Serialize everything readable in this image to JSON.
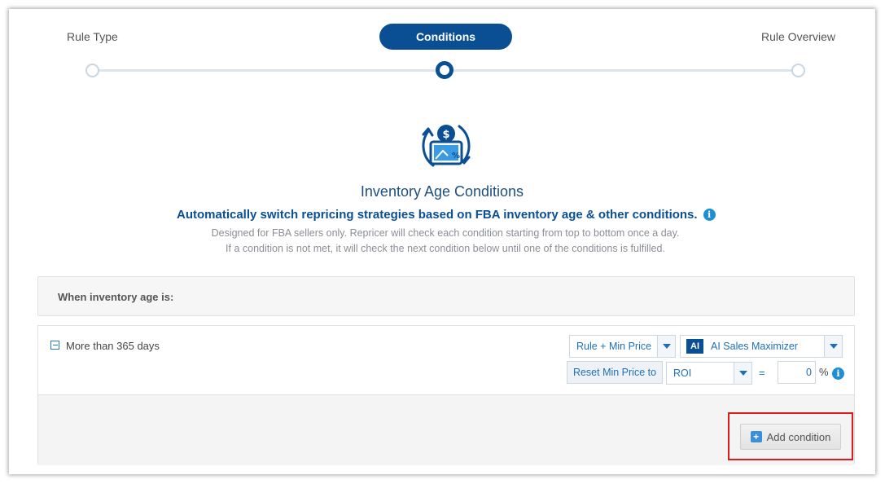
{
  "stepper": {
    "steps": [
      {
        "label": "Rule Type",
        "state": "done"
      },
      {
        "label": "Conditions",
        "state": "active"
      },
      {
        "label": "Rule Overview",
        "state": "pending"
      }
    ]
  },
  "header": {
    "icon": "inventory-repricing-icon",
    "title": "Inventory Age Conditions",
    "subtitle": "Automatically switch repricing strategies based on FBA inventory age & other conditions.",
    "description_line1": "Designed for FBA sellers only. Repricer will check each condition starting from top to bottom once a day.",
    "description_line2": "If a condition is not met, it will check the next condition below until one of the conditions is fulfilled."
  },
  "panel": {
    "heading": "When inventory age is:"
  },
  "condition": {
    "label": "More than 365 days",
    "rule_dropdown": "Rule + Min Price",
    "strategy_badge": "AI",
    "strategy_dropdown": "AI Sales Maximizer",
    "reset_button": "Reset Min Price to",
    "reset_basis_dropdown": "ROI",
    "equals": "=",
    "value": "0",
    "unit": "%"
  },
  "actions": {
    "add_condition": "Add condition",
    "add_icon_glyph": "+"
  },
  "colors": {
    "primary": "#0a4f93",
    "link": "#1f6fb7",
    "highlight": "#e01919"
  }
}
